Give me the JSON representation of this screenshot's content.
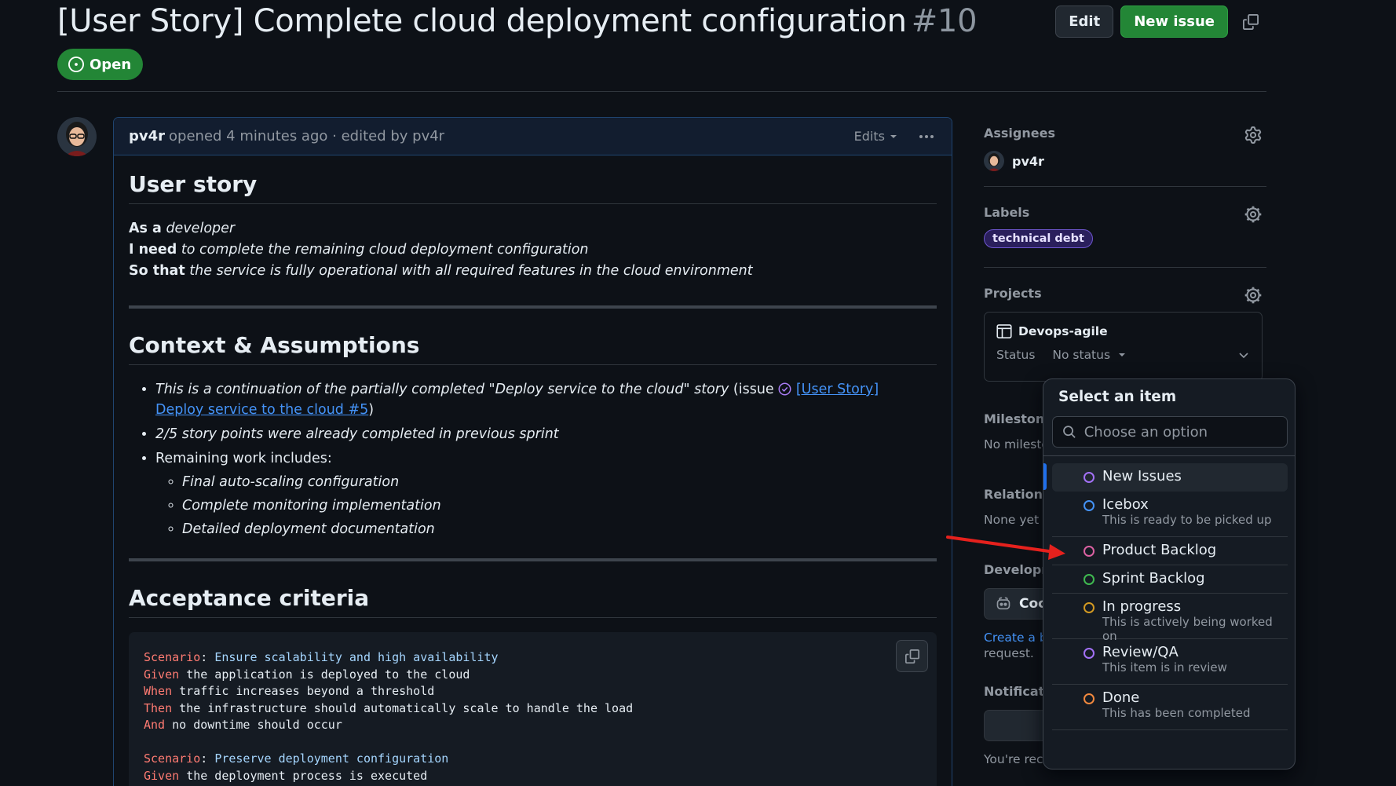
{
  "issue": {
    "title": "[User Story] Complete cloud deployment configuration",
    "number": "#10",
    "state": "Open",
    "edit_label": "Edit",
    "new_issue_label": "New issue"
  },
  "comment": {
    "author": "pv4r",
    "meta": "opened 4 minutes ago · edited by pv4r",
    "edits_label": "Edits",
    "user_story_heading": "User story",
    "as_a_label": "As a",
    "as_a_value": "developer",
    "i_need_label": "I need",
    "i_need_value": "to complete the remaining cloud deployment configuration",
    "so_that_label": "So that",
    "so_that_value": "the service is fully operational with all required features in the cloud environment",
    "context_heading": "Context & Assumptions",
    "context_item1_text": "This is a continuation of the partially completed \"Deploy service to the cloud\" story",
    "context_item1_prefix": "(issue",
    "context_item1_link": "[User Story] Deploy service to the cloud #5",
    "context_item1_suffix": ")",
    "context_item2": "2/5 story points were already completed in previous sprint",
    "context_item3": "Remaining work includes:",
    "sub_items": [
      "Final auto-scaling configuration",
      "Complete monitoring implementation",
      "Detailed deployment documentation"
    ],
    "acceptance_heading": "Acceptance criteria",
    "code_lines": [
      {
        "kw": "Scenario",
        "sep": ": ",
        "rest": "Ensure scalability and high availability",
        "str": true
      },
      {
        "kw": "Given",
        "sep": " ",
        "rest": "the application is deployed to the cloud",
        "str": false
      },
      {
        "kw": "When",
        "sep": " ",
        "rest": "traffic increases beyond a threshold",
        "str": false
      },
      {
        "kw": "Then",
        "sep": " ",
        "rest": "the infrastructure should automatically scale to handle the load",
        "str": false
      },
      {
        "kw": "And",
        "sep": " ",
        "rest": "no downtime should occur",
        "str": false
      },
      {
        "kw": "",
        "sep": "",
        "rest": "",
        "str": false
      },
      {
        "kw": "Scenario",
        "sep": ": ",
        "rest": "Preserve deployment configuration",
        "str": true
      },
      {
        "kw": "Given",
        "sep": " ",
        "rest": "the deployment process is executed",
        "str": false
      }
    ]
  },
  "sidebar": {
    "assignees_title": "Assignees",
    "assignee_name": "pv4r",
    "labels_title": "Labels",
    "label": "technical debt",
    "projects_title": "Projects",
    "project_name": "Devops-agile",
    "status_label": "Status",
    "status_value": "No status",
    "milestone_title": "Milestone",
    "milestone_value": "No milesto",
    "relationships_title": "Relationsh",
    "relationships_value": "None yet",
    "development_title": "Developm",
    "copilot_label": "Coc",
    "create_branch_link": "Create a br",
    "create_branch_rest": "request.",
    "notifications_title": "Notificatio",
    "notifications_text": "You're receiving notifications because you're"
  },
  "dropdown": {
    "title": "Select an item",
    "search_placeholder": "Choose an option",
    "items": [
      {
        "name": "New Issues",
        "desc": "",
        "color": "#a371f7"
      },
      {
        "name": "Icebox",
        "desc": "This is ready to be picked up",
        "color": "#4493f8"
      },
      {
        "name": "Product Backlog",
        "desc": "",
        "color": "#db61a2"
      },
      {
        "name": "Sprint Backlog",
        "desc": "",
        "color": "#3fb950"
      },
      {
        "name": "In progress",
        "desc": "This is actively being worked on",
        "color": "#d29922"
      },
      {
        "name": "Review/QA",
        "desc": "This item is in review",
        "color": "#a371f7"
      },
      {
        "name": "Done",
        "desc": "This has been completed",
        "color": "#f0883e"
      }
    ]
  },
  "colors": {
    "accent_green": "#238636",
    "link_blue": "#4493f8",
    "annotation_arrow": "#e5211d"
  }
}
